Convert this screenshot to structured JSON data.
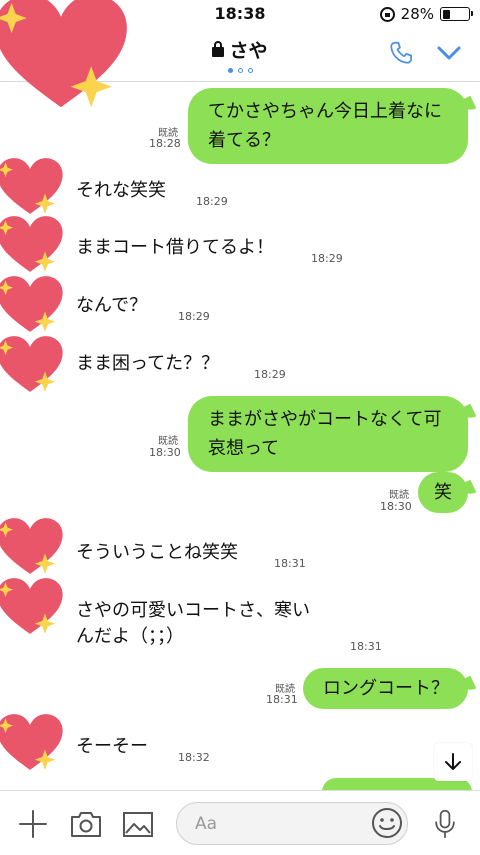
{
  "status_bar": {
    "time": "18:38",
    "battery": "28%",
    "battery_level": 0.28
  },
  "header": {
    "title": "さや"
  },
  "messages": [
    {
      "side": "right",
      "text1": "てかさやちゃん今日上着なに",
      "text2": "着てる？",
      "read": "既読",
      "time": "18:28"
    },
    {
      "side": "left",
      "text": "それな笑笑",
      "time": "18:29"
    },
    {
      "side": "left",
      "text": "ままコート借りてるよ！",
      "time": "18:29"
    },
    {
      "side": "left",
      "text": "なんで？",
      "time": "18:29"
    },
    {
      "side": "left",
      "text": "まま困ってた？？",
      "time": "18:29"
    },
    {
      "side": "right",
      "text1": "ままがさやがコートなくて可",
      "text2": "哀想って",
      "read": "既読",
      "time": "18:30"
    },
    {
      "side": "right",
      "text1": "笑",
      "read": "既読",
      "time": "18:30"
    },
    {
      "side": "left",
      "text": "そういうことね笑笑",
      "time": "18:31"
    },
    {
      "side": "left",
      "text1": "さやの可愛いコートさ、寒い",
      "text2": "んだよ（；；）",
      "time": "18:31"
    },
    {
      "side": "right",
      "text1": "ロングコート？",
      "read": "既読",
      "time": "18:31"
    },
    {
      "side": "left",
      "text": "そーそー",
      "time": "18:32"
    }
  ],
  "input": {
    "placeholder": "Aa"
  },
  "colors": {
    "bubble_green": "#8de055",
    "accent_blue": "#4a90e2",
    "heart_pink": "#e9566a",
    "sparkle_yellow": "#fbd34d"
  }
}
